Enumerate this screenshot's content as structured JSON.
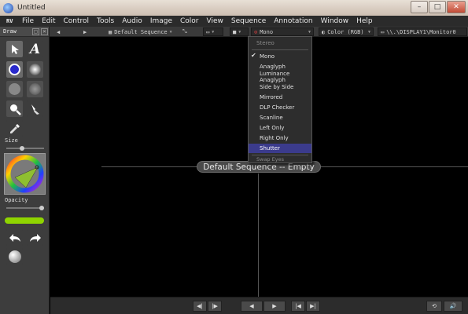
{
  "window": {
    "title": "Untitled",
    "min_glyph": "–",
    "max_glyph": "□",
    "close_glyph": "✕"
  },
  "menubar": {
    "logo": "RV",
    "items": [
      "File",
      "Edit",
      "Control",
      "Tools",
      "Audio",
      "Image",
      "Color",
      "View",
      "Sequence",
      "Annotation",
      "Window",
      "Help"
    ]
  },
  "toolbar": {
    "sequence_label": "Default Sequence",
    "stereo_label": "Mono",
    "color_label": "Color (RGB)",
    "display_label": "\\\\.\\DISPLAY1\\Monitor0"
  },
  "draw_panel": {
    "title": "Draw",
    "size_label": "Size",
    "opacity_label": "Opacity",
    "text_tool_glyph": "A"
  },
  "viewer": {
    "empty_label": "Default Sequence -- Empty"
  },
  "stereo_menu": {
    "header": "Stereo",
    "items": [
      "Mono",
      "Anaglyph",
      "Luminance Anaglyph",
      "Side by Side",
      "Mirrored",
      "DLP Checker",
      "Scanline",
      "Left Only",
      "Right Only",
      "Shutter"
    ],
    "checked": "Mono",
    "highlighted": "Shutter",
    "disabled_item": "Swap Eyes"
  },
  "colors": {
    "accent_green": "#8fd400",
    "menu_highlight": "#3b3b8c",
    "brush_blue": "#2a2acc"
  }
}
